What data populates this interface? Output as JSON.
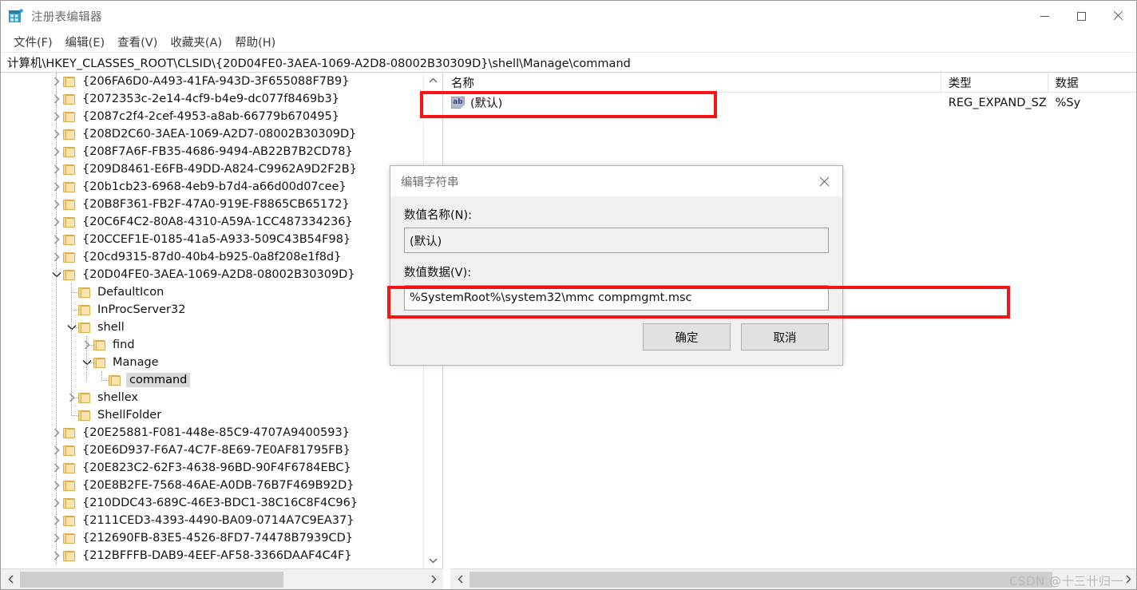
{
  "window": {
    "title": "注册表编辑器",
    "icon": "registry-editor-icon",
    "controls": {
      "minimize": "最小化",
      "maximize": "最大化",
      "close": "关闭"
    }
  },
  "menubar": {
    "items": [
      {
        "label": "文件(F)",
        "text": "文件",
        "accel": "F"
      },
      {
        "label": "编辑(E)",
        "text": "编辑",
        "accel": "E"
      },
      {
        "label": "查看(V)",
        "text": "查看",
        "accel": "V"
      },
      {
        "label": "收藏夹(A)",
        "text": "收藏夹",
        "accel": "A"
      },
      {
        "label": "帮助(H)",
        "text": "帮助",
        "accel": "H"
      }
    ]
  },
  "address": {
    "path": "计算机\\HKEY_CLASSES_ROOT\\CLSID\\{20D04FE0-3AEA-1069-A2D8-08002B30309D}\\shell\\Manage\\command"
  },
  "tree": {
    "rows": [
      {
        "label": "{206FA6D0-A493-41FA-943D-3F655088F7B9}",
        "indent": 0,
        "state": "collapsed"
      },
      {
        "label": "{2072353c-2e14-4cf9-b4e9-dc077f8469b3}",
        "indent": 0,
        "state": "collapsed"
      },
      {
        "label": "{2087c2f4-2cef-4953-a8ab-66779b670495}",
        "indent": 0,
        "state": "collapsed"
      },
      {
        "label": "{208D2C60-3AEA-1069-A2D7-08002B30309D}",
        "indent": 0,
        "state": "collapsed"
      },
      {
        "label": "{208F7A6F-FB35-4686-9494-AB22B7B2CD78}",
        "indent": 0,
        "state": "collapsed"
      },
      {
        "label": "{209D8461-E6FB-49DD-A824-C9962A9D2F2B}",
        "indent": 0,
        "state": "collapsed"
      },
      {
        "label": "{20b1cb23-6968-4eb9-b7d4-a66d00d07cee}",
        "indent": 0,
        "state": "collapsed"
      },
      {
        "label": "{20B8F361-FB2F-47A0-919E-F8865CB65172}",
        "indent": 0,
        "state": "collapsed"
      },
      {
        "label": "{20C6F4C2-80A8-4310-A59A-1CC487334236}",
        "indent": 0,
        "state": "collapsed"
      },
      {
        "label": "{20CCEF1E-0185-41a5-A933-509C43B54F98}",
        "indent": 0,
        "state": "collapsed"
      },
      {
        "label": "{20cd9315-87d0-40b4-b925-0a8f208e1f8d}",
        "indent": 0,
        "state": "collapsed"
      },
      {
        "label": "{20D04FE0-3AEA-1069-A2D8-08002B30309D}",
        "indent": 0,
        "state": "expanded"
      },
      {
        "label": "DefaultIcon",
        "indent": 1,
        "state": "leaf"
      },
      {
        "label": "InProcServer32",
        "indent": 1,
        "state": "leaf"
      },
      {
        "label": "shell",
        "indent": 1,
        "state": "expanded"
      },
      {
        "label": "find",
        "indent": 2,
        "state": "collapsed"
      },
      {
        "label": "Manage",
        "indent": 2,
        "state": "expanded"
      },
      {
        "label": "command",
        "indent": 3,
        "state": "leaf",
        "selected": true
      },
      {
        "label": "shellex",
        "indent": 1,
        "state": "collapsed"
      },
      {
        "label": "ShellFolder",
        "indent": 1,
        "state": "leaf"
      },
      {
        "label": "{20E25881-F081-448e-85C9-4707A9400593}",
        "indent": 0,
        "state": "collapsed"
      },
      {
        "label": "{20E6D937-F6A7-4C7F-8E69-7E0AF81795FB}",
        "indent": 0,
        "state": "collapsed"
      },
      {
        "label": "{20E823C2-62F3-4638-96BD-90F4F6784EBC}",
        "indent": 0,
        "state": "collapsed"
      },
      {
        "label": "{20E8B2FE-7568-46AE-A0DB-76B7F469B92D}",
        "indent": 0,
        "state": "collapsed"
      },
      {
        "label": "{210DDC43-689C-46E3-BDC1-38C16C8F4C96}",
        "indent": 0,
        "state": "collapsed"
      },
      {
        "label": "{2111CED3-4393-4490-BA09-0714A7C9EA37}",
        "indent": 0,
        "state": "collapsed"
      },
      {
        "label": "{212690FB-83E5-4526-8FD7-74478B7939CD}",
        "indent": 0,
        "state": "collapsed"
      },
      {
        "label": "{212BFFFB-DAB9-4EEF-AF58-3366DAAF4C4F}",
        "indent": 0,
        "state": "collapsed"
      }
    ]
  },
  "list": {
    "columns": [
      "名称",
      "类型",
      "数据"
    ],
    "rows": [
      {
        "icon": "string-value-icon",
        "name": "(默认)",
        "type": "REG_EXPAND_SZ",
        "data": "%Sy"
      }
    ]
  },
  "dialog": {
    "title": "编辑字符串",
    "close_label": "关闭",
    "name_label": "数值名称(N):",
    "name_value": "(默认)",
    "data_label": "数值数据(V):",
    "data_value": "%SystemRoot%\\system32\\mmc compmgmt.msc",
    "ok_label": "确定",
    "cancel_label": "取消"
  },
  "annotations": {
    "highlight_color": "#f61414",
    "boxes": [
      "default-value-row-highlight",
      "value-data-field-highlight"
    ]
  },
  "watermark": {
    "text": "CSDN @十三卄归一"
  },
  "scrollbars": {
    "tree_h_thumb_label": "tree-horizontal-thumb",
    "list_h_thumb_label": "list-horizontal-thumb",
    "tree_v_thumb_label": "tree-vertical-thumb",
    "left_arrow": "‹",
    "right_arrow": "›",
    "up_arrow": "⌃",
    "down_arrow": "⌄"
  }
}
